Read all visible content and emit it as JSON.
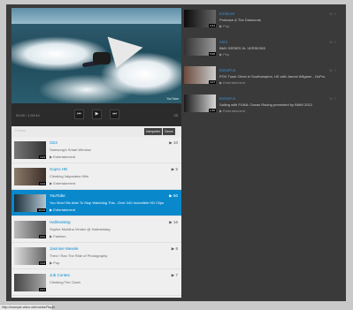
{
  "player": {
    "time": "00:00 / 1:03:44",
    "watermark": "YouTube",
    "prev_icon": "prev-icon",
    "play_icon": "play-icon",
    "next_icon": "next-icon",
    "volume": "23"
  },
  "subbar": {
    "count": "5 Views",
    "btn_1": "Interpreter",
    "btn_2": "Genre"
  },
  "playlist": [
    {
      "duration": "3:23",
      "title": "CE3",
      "desc": "Samsung's Smart Window",
      "category": "Entertainment",
      "views": "10"
    },
    {
      "duration": "3:24",
      "title": "Gopro HD",
      "desc": "Climbing Valparaiso Hills",
      "category": "Entertainment",
      "views": "5"
    },
    {
      "duration": "10:03",
      "title": "YouTube",
      "desc": "You Won't Be Able To Stop Watching This - Over 240 Incredible HD Clips",
      "category": "Entertainment",
      "views": "50"
    },
    {
      "duration": "2:01",
      "title": "Hallmeisteg",
      "desc": "Sophie McAlina Vinden @ Hallmeisteg",
      "category": "Fashion",
      "views": "16"
    },
    {
      "duration": "4:14",
      "title": "Jasmine Mesele",
      "desc": "Then I Ran The Ride of Photography",
      "category": "Pop",
      "views": "8"
    },
    {
      "duration": "3:17",
      "title": "Job Contes",
      "desc": "Climbing The Clash",
      "category": "",
      "views": "7"
    }
  ],
  "related": [
    {
      "duration": "3:44",
      "channel": "Kinfaces",
      "title": "Protease & The Diamonds",
      "category": "Pop",
      "views": "0"
    },
    {
      "duration": "5:06",
      "channel": "CE3",
      "title": "BMX SERIES KL VERSIONS",
      "category": "Pop",
      "views": "0"
    },
    {
      "duration": "4:07",
      "channel": "ExtraFun",
      "title": "POV Track Climb in Southampton, UK with James Wilgane - GoPro",
      "category": "Entertainment",
      "views": "4"
    },
    {
      "duration": "2:36",
      "channel": "ExtraFun",
      "title": "Sailing with FUNA: Ocean Racing presented by BMW 2012",
      "category": "Entertainment",
      "views": "0"
    }
  ],
  "status_text": "Http://example-video-site/media/Player"
}
